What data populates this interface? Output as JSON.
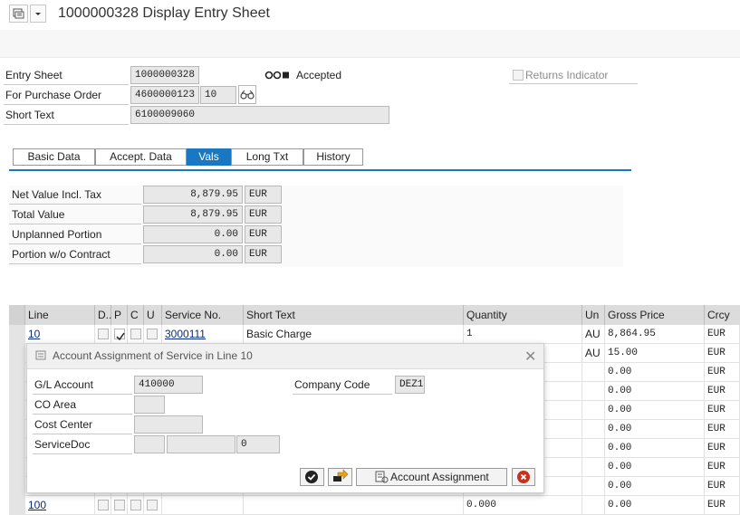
{
  "window": {
    "title": "1000000328 Display Entry Sheet"
  },
  "header": {
    "entry_sheet_label": "Entry Sheet",
    "entry_sheet_value": "1000000328",
    "status_text": "Accepted",
    "returns_indicator_label": "Returns Indicator",
    "purchase_order_label": "For Purchase Order",
    "purchase_order_value": "4600000123",
    "purchase_order_item": "10",
    "short_text_label": "Short Text",
    "short_text_value": "6100009060"
  },
  "tabs": [
    {
      "label": "Basic Data"
    },
    {
      "label": "Accept. Data"
    },
    {
      "label": "Vals",
      "active": true
    },
    {
      "label": "Long Txt"
    },
    {
      "label": "History"
    }
  ],
  "vals": [
    {
      "label": "Net Value Incl. Tax",
      "value": "8,879.95",
      "currency": "EUR"
    },
    {
      "label": "Total Value",
      "value": "8,879.95",
      "currency": "EUR"
    },
    {
      "label": "Unplanned Portion",
      "value": "0.00",
      "currency": "EUR"
    },
    {
      "label": "Portion w/o Contract",
      "value": "0.00",
      "currency": "EUR"
    }
  ],
  "table": {
    "headers": {
      "line": "Line",
      "d": "D..",
      "p": "P",
      "c": "C",
      "u": "U",
      "service_no": "Service No.",
      "short_text": "Short Text",
      "quantity": "Quantity",
      "unit": "Un",
      "gross_price": "Gross Price",
      "currency": "Crcy"
    },
    "rows": [
      {
        "line": "10",
        "p_checked": true,
        "service_no": "3000111",
        "short_text": "Basic Charge",
        "quantity": "1",
        "unit": "AU",
        "gross_price": "8,864.95",
        "currency": "EUR"
      },
      {
        "line": "",
        "p_checked": false,
        "service_no": "",
        "short_text": "",
        "quantity": "",
        "unit": "AU",
        "gross_price": "15.00",
        "currency": "EUR"
      },
      {
        "line": "",
        "service_no": "",
        "short_text": "",
        "quantity": "",
        "unit": "",
        "gross_price": "0.00",
        "currency": "EUR"
      },
      {
        "line": "",
        "service_no": "",
        "short_text": "",
        "quantity": "",
        "unit": "",
        "gross_price": "0.00",
        "currency": "EUR"
      },
      {
        "line": "",
        "service_no": "",
        "short_text": "",
        "quantity": "",
        "unit": "",
        "gross_price": "0.00",
        "currency": "EUR"
      },
      {
        "line": "",
        "service_no": "",
        "short_text": "",
        "quantity": "",
        "unit": "",
        "gross_price": "0.00",
        "currency": "EUR"
      },
      {
        "line": "",
        "service_no": "",
        "short_text": "",
        "quantity": "",
        "unit": "",
        "gross_price": "0.00",
        "currency": "EUR"
      },
      {
        "line": "",
        "service_no": "",
        "short_text": "",
        "quantity": "",
        "unit": "",
        "gross_price": "0.00",
        "currency": "EUR"
      },
      {
        "line": "",
        "service_no": "",
        "short_text": "",
        "quantity": "",
        "unit": "",
        "gross_price": "0.00",
        "currency": "EUR"
      },
      {
        "line": "100",
        "service_no": "",
        "short_text": "",
        "quantity": "0.000",
        "unit": "",
        "gross_price": "0.00",
        "currency": "EUR"
      }
    ]
  },
  "dialog": {
    "title": "Account Assignment of Service in Line 10",
    "gl_account_label": "G/L Account",
    "gl_account_value": "410000",
    "company_code_label": "Company Code",
    "company_code_value": "DEZ1",
    "co_area_label": "CO Area",
    "cost_center_label": "Cost Center",
    "service_doc_label": "ServiceDoc",
    "service_doc_item": "0",
    "account_assignment_button": "Account Assignment"
  },
  "colors": {
    "accent": "#1a78c2",
    "cancel_red": "#c8311c",
    "status_dark": "#222222"
  }
}
